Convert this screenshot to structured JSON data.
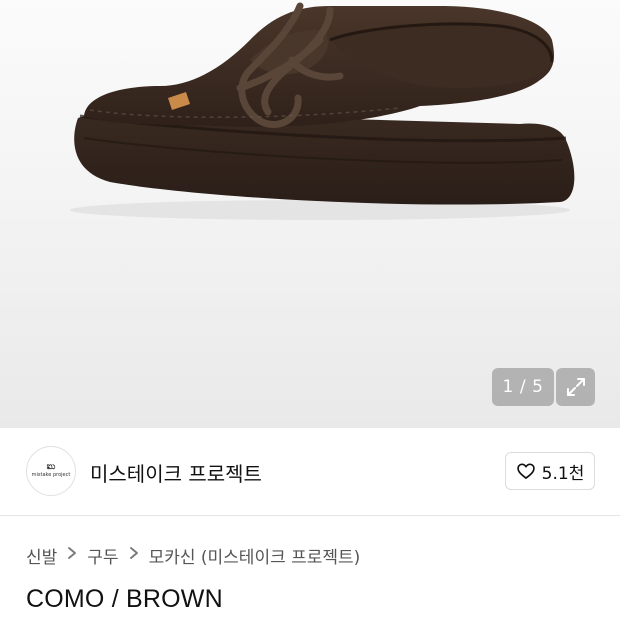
{
  "gallery": {
    "current": "1",
    "separator": "/",
    "total": "5",
    "expand_icon": "expand-icon",
    "shoe_color": "#3b2a20"
  },
  "brand": {
    "logo_mark": "ಐು",
    "logo_sub": "mistake project",
    "name": "미스테이크 프로젝트",
    "like_icon": "heart-icon",
    "like_count": "5.1천"
  },
  "breadcrumb": {
    "items": [
      "신발",
      "구두",
      "모카신 (미스테이크 프로젝트)"
    ],
    "chevron_icon": "chevron-right-icon"
  },
  "product": {
    "title": "COMO / BROWN"
  }
}
